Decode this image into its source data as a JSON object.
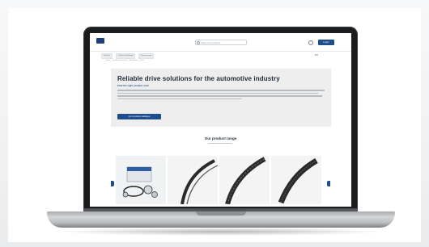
{
  "site": {
    "search_placeholder": "Search by product",
    "login_label": "Login",
    "language": "EN",
    "nav": [
      "Products",
      "Technical knowledge",
      "Service center"
    ],
    "breadcrumb": [
      "Home",
      "Products & services",
      "Automotive",
      "Drive"
    ],
    "hero": {
      "title": "Reliable drive solutions for the automotive industry",
      "subtitle": "Find the right product now!",
      "button": "Go to product catalogue"
    },
    "range_title": "Our product range",
    "products": [
      {
        "icon": "timing-belt-kit-icon"
      },
      {
        "icon": "v-belt-icon"
      },
      {
        "icon": "ribbed-belt-icon"
      },
      {
        "icon": "multi-rib-belt-icon"
      }
    ]
  },
  "colors": {
    "brand_blue": "#1e4e8c",
    "laptop_body": "#1b1c1e",
    "hero_bg": "#eeeeef"
  }
}
